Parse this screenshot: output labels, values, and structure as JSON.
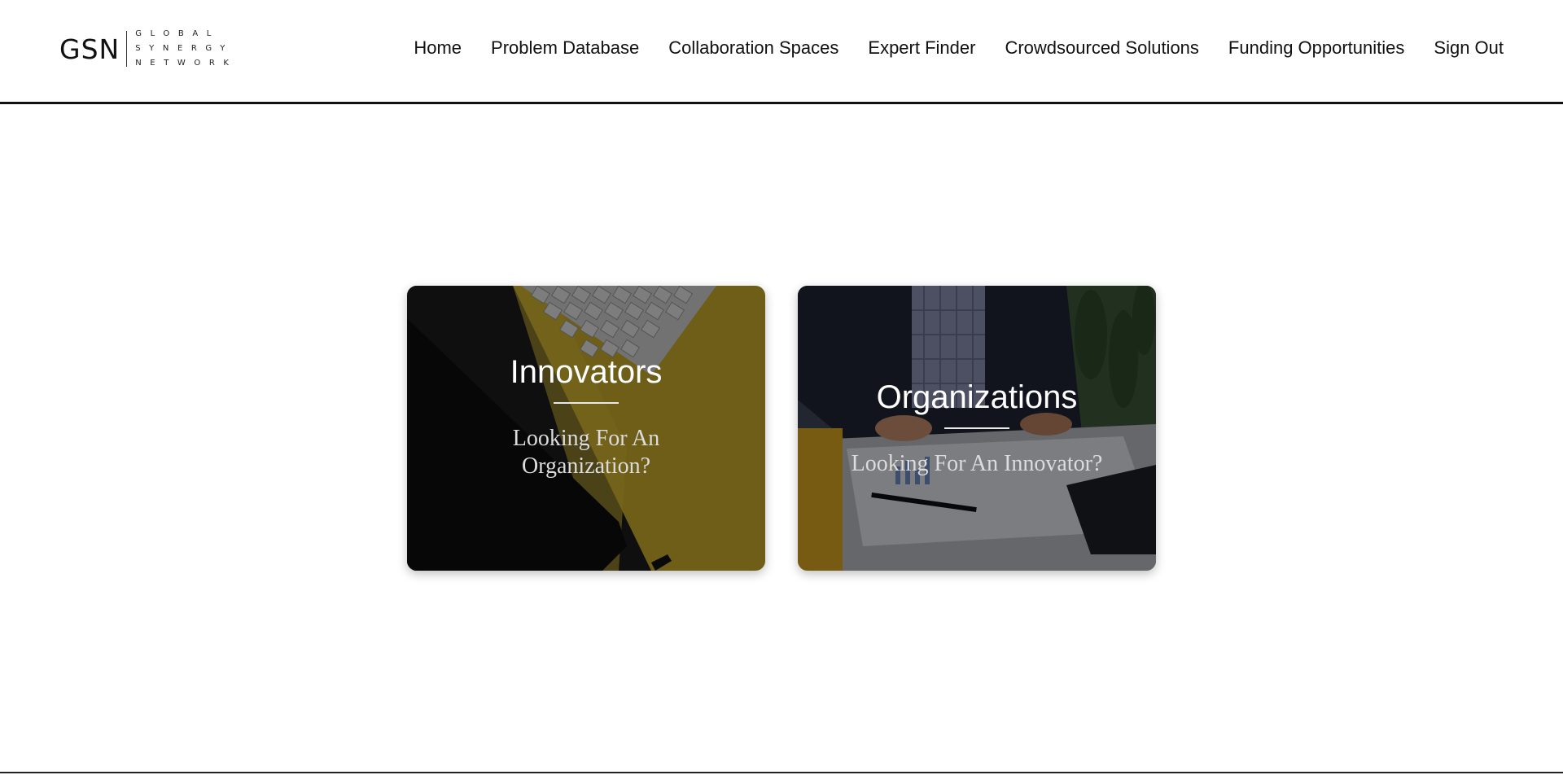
{
  "logo": {
    "mark": "GSN",
    "words": [
      "GLOBAL",
      "SYNERGY",
      "NETWORK"
    ]
  },
  "nav": {
    "items": [
      "Home",
      "Problem Database",
      "Collaboration Spaces",
      "Expert Finder",
      "Crowdsourced Solutions",
      "Funding Opportunities",
      "Sign Out"
    ]
  },
  "cards": [
    {
      "title": "Innovators",
      "subtitle": "Looking For An Organization?",
      "image": "desk-keyboard-tablet-photo"
    },
    {
      "title": "Organizations",
      "subtitle": "Looking For An Innovator?",
      "image": "businessman-documents-photo"
    }
  ],
  "colors": {
    "text": "#111111",
    "card_title": "#ffffff",
    "card_subtitle": "#dcdcdc",
    "innovators_accent": "#c4a92a",
    "organizations_accent": "#2b3447"
  }
}
